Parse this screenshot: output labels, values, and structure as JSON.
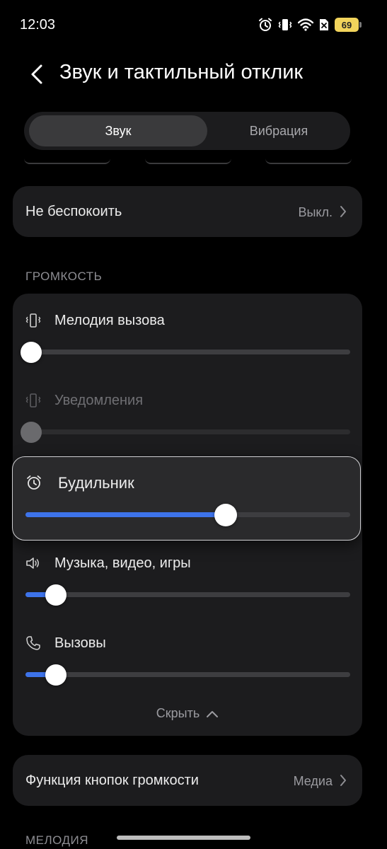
{
  "status_bar": {
    "time": "12:03",
    "battery": "69",
    "icons": [
      "alarm-icon",
      "vibrate-icon",
      "wifi-icon",
      "sim-off-icon",
      "battery-icon"
    ]
  },
  "header": {
    "back_icon": "chevron-left-icon",
    "title": "Звук и тактильный отклик"
  },
  "tabs": [
    {
      "label": "Звук",
      "active": true
    },
    {
      "label": "Вибрация",
      "active": false
    }
  ],
  "dnd": {
    "label": "Не беспокоить",
    "value": "Выкл."
  },
  "volume": {
    "section_title": "ГРОМКОСТЬ",
    "items": [
      {
        "label": "Мелодия вызова",
        "icon": "vibrate-icon",
        "level_percent": 0,
        "enabled": true
      },
      {
        "label": "Уведомления",
        "icon": "vibrate-icon",
        "level_percent": 0,
        "enabled": false
      },
      {
        "label": "Будильник",
        "icon": "alarm-clock-icon",
        "level_percent": 62,
        "enabled": true
      },
      {
        "label": "Музыка, видео, игры",
        "icon": "speaker-icon",
        "level_percent": 8,
        "enabled": true
      },
      {
        "label": "Вызовы",
        "icon": "phone-icon",
        "level_percent": 8,
        "enabled": true
      }
    ],
    "collapse_label": "Скрыть"
  },
  "volume_buttons": {
    "label": "Функция кнопок громкости",
    "value": "Медиа"
  },
  "next_section_title": "МЕЛОДИЯ",
  "colors": {
    "accent": "#3d73ea",
    "background": "#000000",
    "card": "#1c1c1e",
    "battery": "#f2d45c"
  }
}
